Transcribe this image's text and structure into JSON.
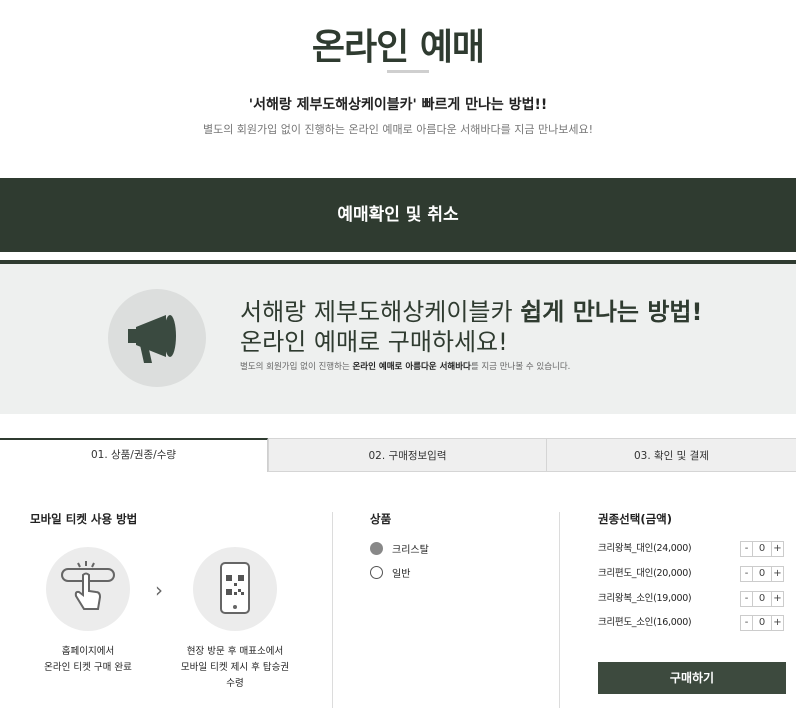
{
  "header": {
    "title": "온라인 예매",
    "headline": "'서해랑 제부도해상케이블카' 빠르게 만나는 방법!!",
    "subline": "별도의 회원가입 없이 진행하는 온라인 예매로 아름다운 서해바다를 지금 만나보세요!"
  },
  "band": {
    "label": "예매확인 및 취소"
  },
  "promo": {
    "line1_normal": "서해랑 제부도해상케이블카 ",
    "line1_bold": "쉽게 만나는 방법!",
    "line2": "온라인 예매로 구매하세요!",
    "small_pre": "별도의 회원가입 없이 진행하는 ",
    "small_bold": "온라인 예매로 아름다운 서해바다",
    "small_post": "를 지금 만나볼 수 있습니다.",
    "icon": "megaphone-icon"
  },
  "tabs": [
    {
      "label": "01. 상품/권종/수량",
      "active": true
    },
    {
      "label": "02. 구매정보입력",
      "active": false
    },
    {
      "label": "03. 확인 및 결제",
      "active": false
    }
  ],
  "mobile_guide": {
    "title": "모바일 티켓 사용 방법",
    "step1_line1": "홈페이지에서",
    "step1_line2": "온라인 티켓 구매 완료",
    "step2_line1": "현장 방문 후 매표소에서",
    "step2_line2": "모바일 티켓 제시 후 탑승권",
    "step2_line3": "수령",
    "arrow": "›"
  },
  "product": {
    "title": "상품",
    "options": [
      {
        "label": "크리스탈",
        "checked": true
      },
      {
        "label": "일반",
        "checked": false
      }
    ]
  },
  "tickets": {
    "title": "권종선택(금액)",
    "minus": "-",
    "plus": "+",
    "items": [
      {
        "label": "크리왕복_대인(24,000)",
        "qty": "0"
      },
      {
        "label": "크리편도_대인(20,000)",
        "qty": "0"
      },
      {
        "label": "크리왕복_소인(19,000)",
        "qty": "0"
      },
      {
        "label": "크리편도_소인(16,000)",
        "qty": "0"
      }
    ],
    "buy_label": "구매하기"
  },
  "colors": {
    "brand_green": "#2f3b30",
    "button_green": "#3d4a3e",
    "promo_bg": "#eef0ef"
  }
}
